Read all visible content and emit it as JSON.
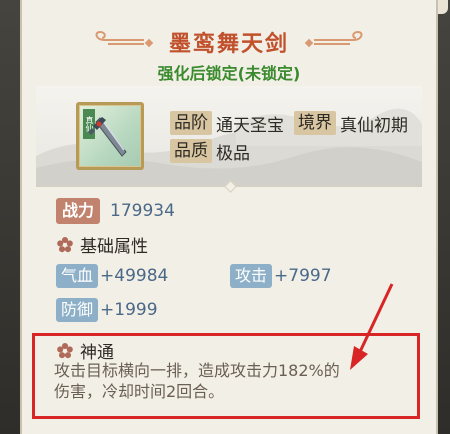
{
  "item": {
    "name": "墨鸾舞天剑",
    "lock_status": "强化后锁定(未锁定)",
    "icon_tag": "真仙",
    "grade_label": "品阶",
    "grade_value": "通天圣宝",
    "realm_label": "境界",
    "realm_value": "真仙初期",
    "quality_label": "品质",
    "quality_value": "极品"
  },
  "power": {
    "label": "战力",
    "value": "179934"
  },
  "base_attributes": {
    "title": "基础属性",
    "stats": [
      {
        "label": "气血",
        "value": "+49984"
      },
      {
        "label": "攻击",
        "value": "+7997"
      },
      {
        "label": "防御",
        "value": "+1999"
      }
    ]
  },
  "skill": {
    "title": "神通",
    "description_line1": "攻击目标横向一排，造成攻击力182%的",
    "description_line2": "伤害，冷却时间2回合。"
  },
  "colors": {
    "title": "#c0512c",
    "lock_text": "#3a8a2e",
    "power_chip": "#c1826e",
    "stat_chip": "#8db0c8",
    "stat_value": "#4a6888",
    "highlight_box": "#d82525"
  }
}
